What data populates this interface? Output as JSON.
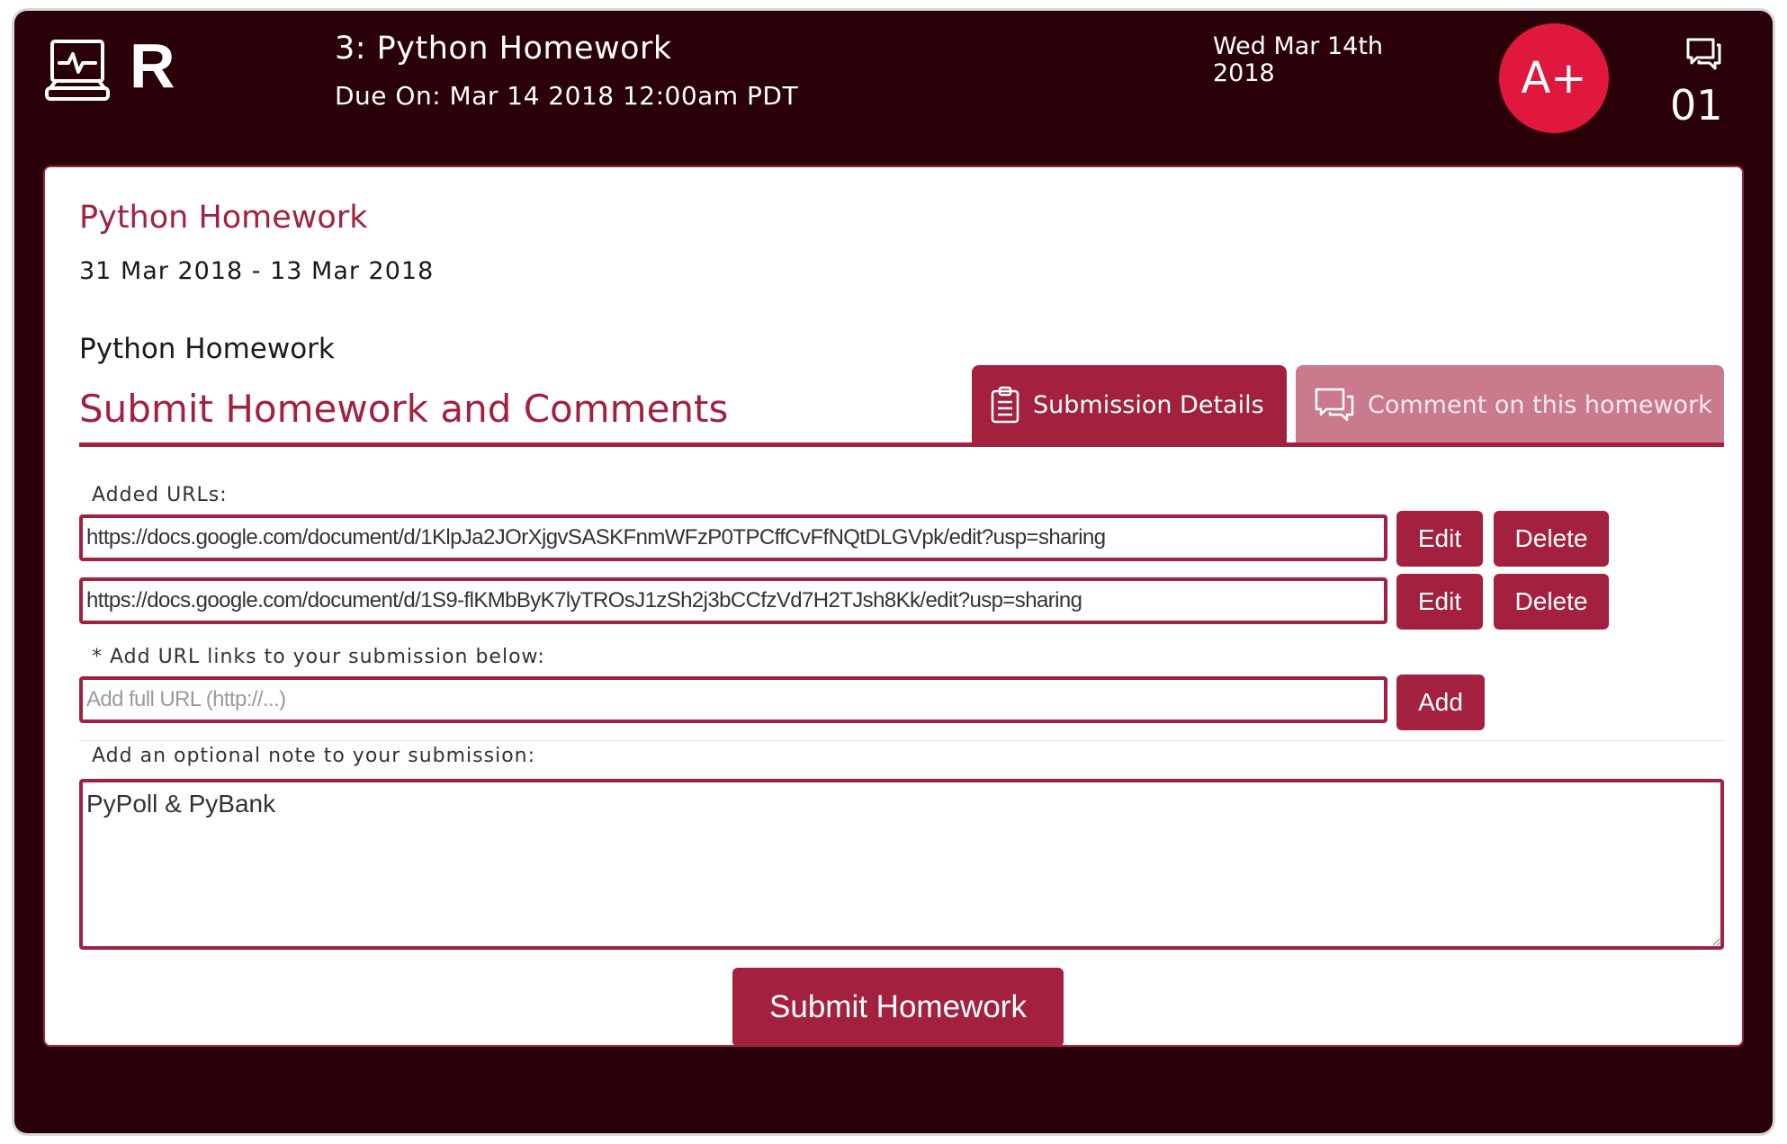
{
  "header": {
    "brand_letter": "R",
    "assignment_title": "3: Python Homework",
    "due_text": "Due On: Mar 14 2018 12:00am PDT",
    "date_line1": "Wed Mar 14th",
    "date_line2": "2018",
    "grade": "A+",
    "message_count": "01"
  },
  "card": {
    "title": "Python Homework",
    "date_range": "31 Mar 2018 - 13 Mar 2018",
    "description": "Python Homework",
    "section_title": "Submit Homework and Comments"
  },
  "tabs": [
    {
      "label": "Submission Details",
      "active": true
    },
    {
      "label": "Comment on this homework",
      "active": false
    }
  ],
  "form": {
    "added_urls_label": "Added URLs:",
    "urls": [
      "https://docs.google.com/document/d/1KlpJa2JOrXjgvSASKFnmWFzP0TPCffCvFfNQtDLGVpk/edit?usp=sharing",
      "https://docs.google.com/document/d/1S9-flKMbByK7lyTROsJ1zSh2j3bCCfzVd7H2TJsh8Kk/edit?usp=sharing"
    ],
    "edit_label": "Edit",
    "delete_label": "Delete",
    "add_url_label": "* Add URL links to your submission below:",
    "add_url_placeholder": "Add full URL (http://...)",
    "add_label": "Add",
    "note_label": "Add an optional note to your submission:",
    "note_value": "PyPoll & PyBank",
    "submit_label": "Submit Homework"
  },
  "colors": {
    "background": "#2a0009",
    "accent": "#a3213f",
    "grade_badge": "#e0183d",
    "inactive_tab": "#c97a8d"
  },
  "icons": {
    "app": "monitor-pulse-icon",
    "messages": "chat-bubbles-icon",
    "submission_tab": "clipboard-icon",
    "comment_tab": "chat-bubbles-icon"
  }
}
